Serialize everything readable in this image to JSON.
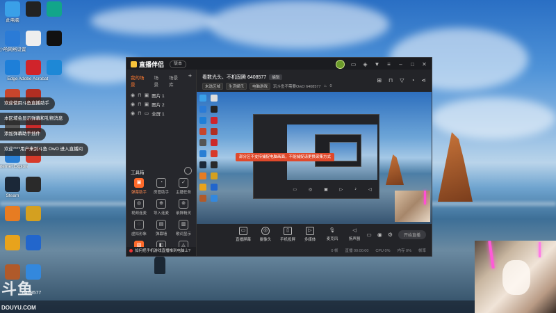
{
  "desktop": {
    "icons_col1": [
      {
        "label": "此电脑",
        "icon": "computer-icon",
        "color": "#3aa0e8"
      },
      {
        "label": "小哈网络设置",
        "icon": "network-icon",
        "color": "#2b7bd6"
      },
      {
        "label": "Edge",
        "icon": "edge-icon",
        "color": "#1e7fd8"
      },
      {
        "label": "",
        "icon": "app-icon",
        "color": "#c7452c"
      },
      {
        "label": "",
        "icon": "app-icon",
        "color": "#555555"
      },
      {
        "label": "Internet Explorer",
        "icon": "ie-icon",
        "color": "#2a7fd4"
      },
      {
        "label": "Steam",
        "icon": "steam-icon",
        "color": "#1b2838"
      },
      {
        "label": "",
        "icon": "app-icon",
        "color": "#e77c22"
      },
      {
        "label": "",
        "icon": "app-icon",
        "color": "#e8a31c"
      },
      {
        "label": "",
        "icon": "app-icon",
        "color": "#b05a2a"
      }
    ],
    "icons_col2": [
      {
        "label": "",
        "icon": "app-icon",
        "color": "#222222"
      },
      {
        "label": "",
        "icon": "file-icon",
        "color": "#eeeeee"
      },
      {
        "label": "Adobe Acrobat",
        "icon": "acrobat-icon",
        "color": "#d0242b"
      },
      {
        "label": "",
        "icon": "app-icon",
        "color": "#b12e22"
      },
      {
        "label": "",
        "icon": "app-icon",
        "color": "#cc2a2a"
      },
      {
        "label": "",
        "icon": "app-icon",
        "color": "#d73a2a"
      },
      {
        "label": "",
        "icon": "app-icon",
        "color": "#2a2a2a"
      },
      {
        "label": "",
        "icon": "app-icon",
        "color": "#d4a020"
      },
      {
        "label": "",
        "icon": "app-icon",
        "color": "#2266cc"
      },
      {
        "label": "",
        "icon": "app-icon",
        "color": "#3388dd"
      }
    ],
    "icons_col3": [
      {
        "label": "",
        "icon": "app-icon",
        "color": "#12a58a"
      },
      {
        "label": "",
        "icon": "mw-icon",
        "color": "#111111"
      },
      {
        "label": "",
        "icon": "app-icon",
        "color": "#1e88d6"
      }
    ],
    "toasts": [
      "欢迎使用斗鱼直播助手",
      "本区域会显示弹幕和礼物消息",
      "添加弹幕助手插件",
      "欢迎****用户来到斗鱼 OwO 进入直播间"
    ],
    "douyu_watermark": {
      "big": "斗鱼",
      "room_id": "6408577",
      "domain": "DOUYU.COM"
    }
  },
  "app": {
    "brand": "直播伴侣",
    "version": "版本",
    "left_tabs": [
      "我的场景",
      "场景",
      "场景库"
    ],
    "scenes": [
      "图片 1",
      "图片 2",
      "全屏 1"
    ],
    "tools_title": "工具箱",
    "tools": [
      {
        "label": "弹幕助手",
        "hot": true
      },
      {
        "label": "房管助手",
        "hot": false
      },
      {
        "label": "主播任务",
        "hot": false
      },
      {
        "label": "视频连麦",
        "hot": false
      },
      {
        "label": "导入连麦",
        "hot": false
      },
      {
        "label": "录屏精灵",
        "hot": false
      },
      {
        "label": "虚拟形象",
        "hot": false
      },
      {
        "label": "弹幕墙",
        "hot": false
      },
      {
        "label": "歌词显示",
        "hot": false
      },
      {
        "label": "",
        "hot": true
      },
      {
        "label": "",
        "hot": false
      },
      {
        "label": "",
        "hot": false
      }
    ],
    "bottom_tip": "如何把手机游戏直播推到电脑上?",
    "room_title": "看数光头、不机固腾 6408577",
    "edit_label": "编辑",
    "sub_items": [
      "未选区域",
      "生活娱乐",
      "电脑游戏",
      "玩斗鱼不需要OwO 6408577"
    ],
    "sub_heat": "0",
    "preview_banner": "部分区不支持捕捉电脑画面，不能捕捉请更换采集方式",
    "controls": [
      "直播屏幕",
      "摄像头",
      "手机投屏",
      "多媒体",
      "麦克风",
      "扬声器"
    ],
    "start_label": "开始直播",
    "status": [
      "0 帧",
      "直播 00:00:00",
      "CPU 0%",
      "内存 0%",
      "帧率"
    ],
    "accent_color": "#ff6a2a"
  }
}
